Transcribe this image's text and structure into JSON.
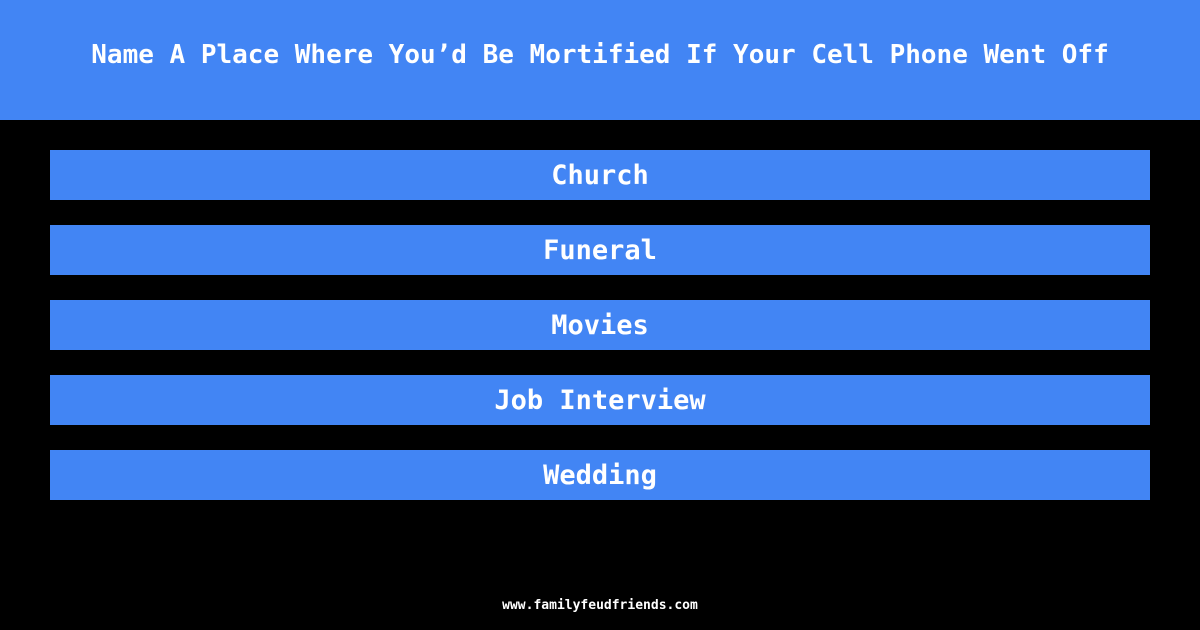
{
  "question": "Name A Place Where You’d Be Mortified If Your Cell Phone Went Off",
  "answers": [
    {
      "label": "Church"
    },
    {
      "label": "Funeral"
    },
    {
      "label": "Movies"
    },
    {
      "label": "Job Interview"
    },
    {
      "label": "Wedding"
    }
  ],
  "footer": {
    "site": "www.familyfeudfriends.com"
  },
  "colors": {
    "accent": "#4285f4",
    "background": "#000000",
    "text": "#ffffff"
  }
}
